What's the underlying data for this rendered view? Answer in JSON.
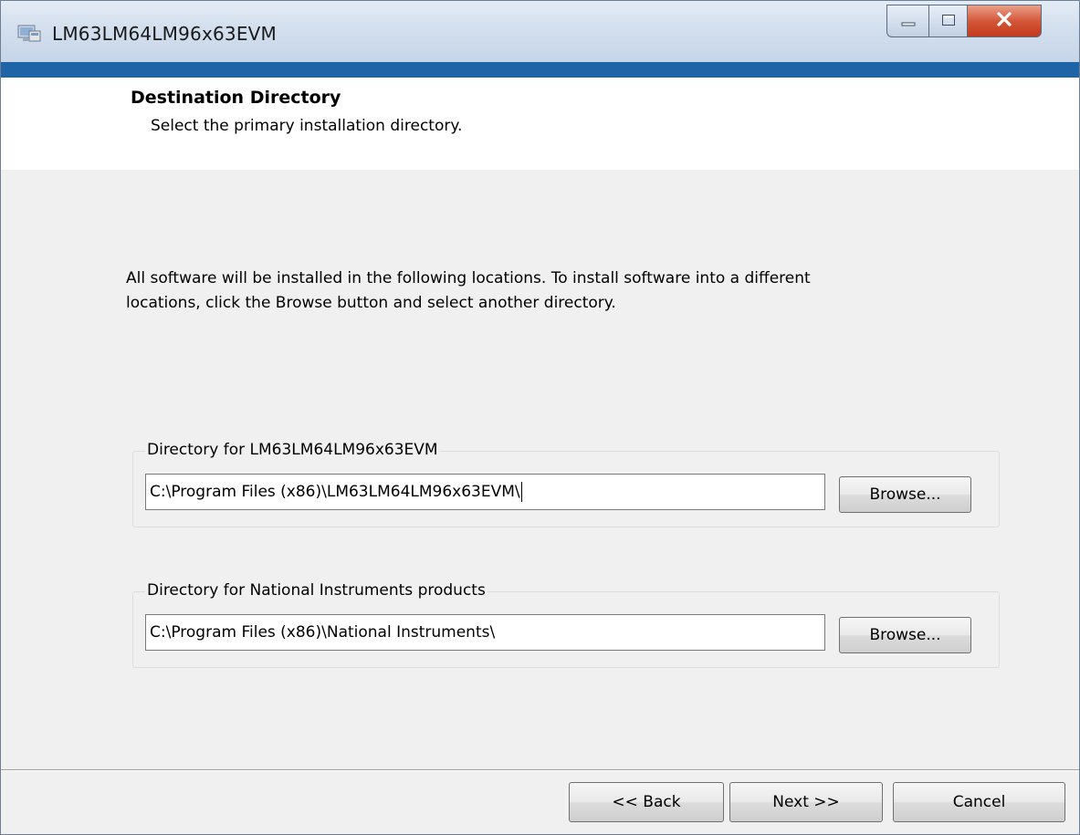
{
  "window": {
    "title": "LM63LM64LM96x63EVM",
    "icon": "installer-icon"
  },
  "caption_buttons": {
    "minimize_icon": "minimize-icon",
    "maximize_icon": "maximize-icon",
    "close_icon": "close-icon"
  },
  "header": {
    "title": "Destination Directory",
    "subtitle": "Select the primary installation directory."
  },
  "description": "All software will be installed in the following locations. To install software into a different locations, click the Browse button and select another directory.",
  "directories": [
    {
      "label": "Directory for LM63LM64LM96x63EVM",
      "value": "C:\\Program Files (x86)\\LM63LM64LM96x63EVM\\",
      "browse_label": "Browse..."
    },
    {
      "label": "Directory for National Instruments products",
      "value": "C:\\Program Files (x86)\\National Instruments\\",
      "browse_label": "Browse..."
    }
  ],
  "footer": {
    "back_label": "<< Back",
    "next_label": "Next >>",
    "cancel_label": "Cancel"
  },
  "colors": {
    "accent_bar": "#1f64a6",
    "close_button": "#c1391b"
  }
}
